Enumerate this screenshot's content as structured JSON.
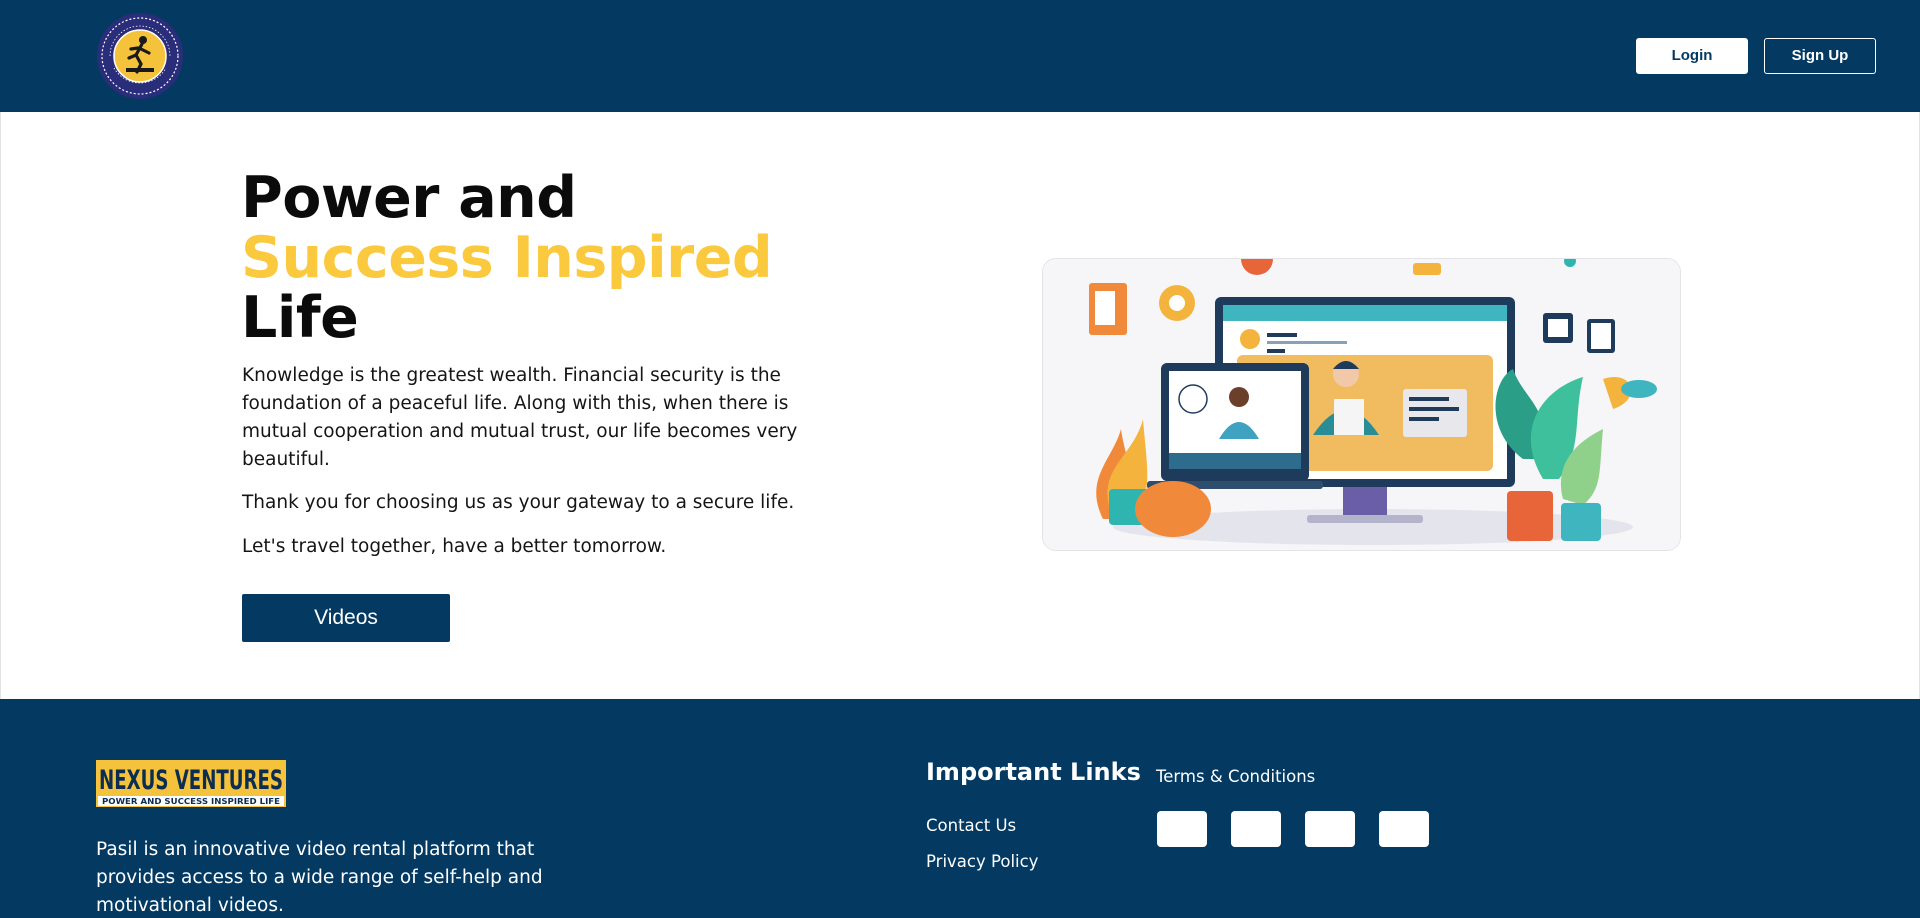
{
  "header": {
    "seal_text": "POWER AND SUCCESS INSPIRED LIFE",
    "login_label": "Login",
    "signup_label": "Sign Up"
  },
  "hero": {
    "title_line1": "Power and",
    "title_line2": "Success Inspired",
    "title_line3": "Life",
    "paragraph1": "Knowledge is the greatest wealth. Financial security is the foundation of a peaceful life. Along with this, when there is mutual cooperation and mutual trust, our life becomes very beautiful.",
    "paragraph2": "Thank you for choosing us as your gateway to a secure life.",
    "paragraph3": "Let's travel together, have a better tomorrow.",
    "videos_label": "Videos"
  },
  "footer": {
    "logo_name": "NEXUS VENTURES",
    "logo_tagline": "POWER AND SUCCESS INSPIRED LIFE",
    "description": "Pasil is an innovative video rental platform that provides access to a wide range of self-help and motivational videos.",
    "links_title": "Important Links",
    "terms_label": "Terms & Conditions",
    "contact_label": "Contact Us",
    "privacy_label": "Privacy Policy"
  },
  "colors": {
    "navy": "#043a62",
    "gold": "#fbc93d",
    "white": "#ffffff"
  },
  "icons": [
    "site-seal-logo",
    "e-learning-illustration",
    "nexus-ventures-logo",
    "social-icon"
  ]
}
